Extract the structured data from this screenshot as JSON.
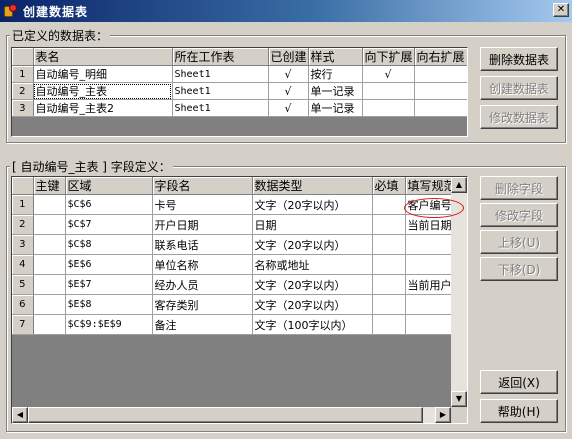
{
  "window": {
    "title": "创建数据表",
    "close_symbol": "✕"
  },
  "defined_tables": {
    "label": "已定义的数据表：",
    "columns": [
      "表名",
      "所在工作表",
      "已创建",
      "样式",
      "向下扩展",
      "向右扩展"
    ],
    "rows": [
      {
        "num": "1",
        "name": "自动编号_明细",
        "sheet": "Sheet1",
        "created": "√",
        "style": "按行",
        "down": "√",
        "right": ""
      },
      {
        "num": "2",
        "name": "自动编号_主表",
        "sheet": "Sheet1",
        "created": "√",
        "style": "单一记录",
        "down": "",
        "right": ""
      },
      {
        "num": "3",
        "name": "自动编号_主表2",
        "sheet": "Sheet1",
        "created": "√",
        "style": "单一记录",
        "down": "",
        "right": ""
      }
    ],
    "buttons": {
      "delete": "删除数据表",
      "create": "创建数据表",
      "modify": "修改数据表"
    }
  },
  "field_defs": {
    "label": "[ 自动编号_主表 ] 字段定义：",
    "columns": [
      "主键",
      "区域",
      "字段名",
      "数据类型",
      "必填",
      "填写规范"
    ],
    "rows": [
      {
        "num": "1",
        "pk": "",
        "range": "$C$6",
        "field": "卡号",
        "type": "文字（20字以内）",
        "required": "",
        "rule": "客户编号"
      },
      {
        "num": "2",
        "pk": "",
        "range": "$C$7",
        "field": "开户日期",
        "type": "日期",
        "required": "",
        "rule": "当前日期"
      },
      {
        "num": "3",
        "pk": "",
        "range": "$C$8",
        "field": "联系电话",
        "type": "文字（20字以内）",
        "required": "",
        "rule": ""
      },
      {
        "num": "4",
        "pk": "",
        "range": "$E$6",
        "field": "单位名称",
        "type": "名称或地址",
        "required": "",
        "rule": ""
      },
      {
        "num": "5",
        "pk": "",
        "range": "$E$7",
        "field": "经办人员",
        "type": "文字（20字以内）",
        "required": "",
        "rule": "当前用户姓"
      },
      {
        "num": "6",
        "pk": "",
        "range": "$E$8",
        "field": "客存类别",
        "type": "文字（20字以内）",
        "required": "",
        "rule": ""
      },
      {
        "num": "7",
        "pk": "",
        "range": "$C$9:$E$9",
        "field": "备注",
        "type": "文字（100字以内）",
        "required": "",
        "rule": ""
      }
    ],
    "buttons": {
      "delete_field": "删除字段",
      "modify_field": "修改字段",
      "move_up": "上移(U)",
      "move_down": "下移(D)"
    }
  },
  "footer_buttons": {
    "back": "返回(X)",
    "help": "帮助(H)"
  }
}
